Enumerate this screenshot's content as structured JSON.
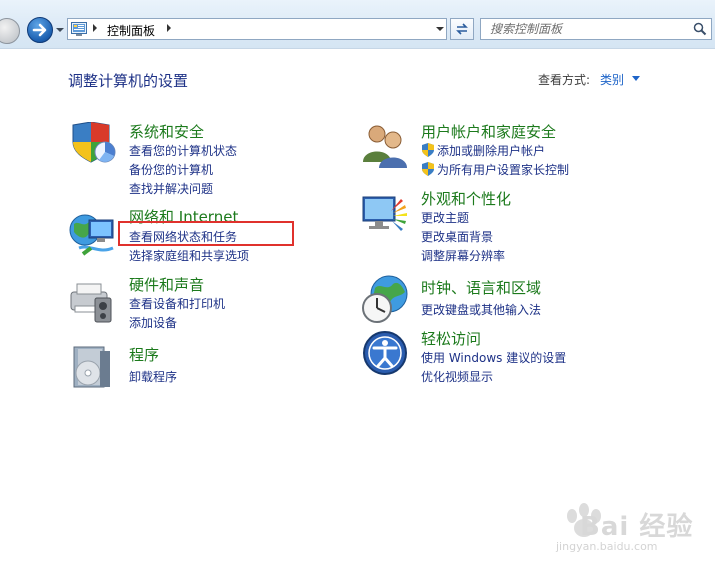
{
  "toolbar": {
    "breadcrumb": "控制面板",
    "search_placeholder": "搜索控制面板"
  },
  "header": {
    "title": "调整计算机的设置",
    "view_by_label": "查看方式:",
    "view_by_value": "类别"
  },
  "categories": {
    "system": {
      "title": "系统和安全",
      "links": [
        "查看您的计算机状态",
        "备份您的计算机",
        "查找并解决问题"
      ]
    },
    "network": {
      "title": "网络和 Internet",
      "links": [
        "查看网络状态和任务",
        "选择家庭组和共享选项"
      ]
    },
    "hardware": {
      "title": "硬件和声音",
      "links": [
        "查看设备和打印机",
        "添加设备"
      ]
    },
    "programs": {
      "title": "程序",
      "links": [
        "卸载程序"
      ]
    },
    "user_accounts": {
      "title": "用户帐户和家庭安全",
      "links": [
        "添加或删除用户帐户",
        "为所有用户设置家长控制"
      ]
    },
    "appearance": {
      "title": "外观和个性化",
      "links": [
        "更改主题",
        "更改桌面背景",
        "调整屏幕分辨率"
      ]
    },
    "clock": {
      "title": "时钟、语言和区域",
      "links": [
        "更改键盘或其他输入法"
      ]
    },
    "ease": {
      "title": "轻松访问",
      "links": [
        "使用 Windows 建议的设置",
        "优化视频显示"
      ]
    }
  },
  "watermark": {
    "text": "Bai 经验",
    "sub": "jingyan.baidu.com"
  },
  "colors": {
    "category_title": "#1c7a1c",
    "link": "#1e3287",
    "highlight": "#e0312c",
    "toolbar": "#dbe9f6"
  }
}
